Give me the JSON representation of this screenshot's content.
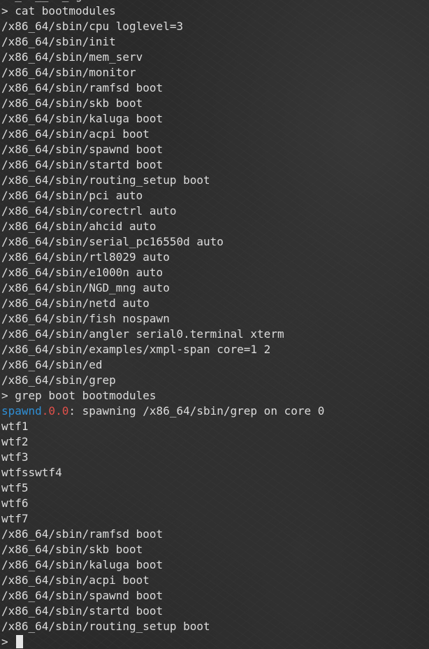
{
  "terminal": {
    "lines": [
      {
        "text": "  _  __  _ g"
      },
      {
        "text": "> cat bootmodules"
      },
      {
        "text": "/x86_64/sbin/cpu loglevel=3"
      },
      {
        "text": "/x86_64/sbin/init"
      },
      {
        "text": "/x86_64/sbin/mem_serv"
      },
      {
        "text": "/x86_64/sbin/monitor"
      },
      {
        "text": "/x86_64/sbin/ramfsd boot"
      },
      {
        "text": "/x86_64/sbin/skb boot"
      },
      {
        "text": "/x86_64/sbin/kaluga boot"
      },
      {
        "text": "/x86_64/sbin/acpi boot"
      },
      {
        "text": "/x86_64/sbin/spawnd boot"
      },
      {
        "text": "/x86_64/sbin/startd boot"
      },
      {
        "text": "/x86_64/sbin/routing_setup boot"
      },
      {
        "text": "/x86_64/sbin/pci auto"
      },
      {
        "text": "/x86_64/sbin/corectrl auto"
      },
      {
        "text": "/x86_64/sbin/ahcid auto"
      },
      {
        "text": "/x86_64/sbin/serial_pc16550d auto"
      },
      {
        "text": "/x86_64/sbin/rtl8029 auto"
      },
      {
        "text": "/x86_64/sbin/e1000n auto"
      },
      {
        "text": "/x86_64/sbin/NGD_mng auto"
      },
      {
        "text": "/x86_64/sbin/netd auto"
      },
      {
        "text": "/x86_64/sbin/fish nospawn"
      },
      {
        "text": "/x86_64/sbin/angler serial0.terminal xterm"
      },
      {
        "text": "/x86_64/sbin/examples/xmpl-span core=1 2"
      },
      {
        "text": "/x86_64/sbin/ed"
      },
      {
        "text": "/x86_64/sbin/grep"
      },
      {
        "text": "> grep boot bootmodules"
      },
      {
        "name": "spawnd",
        "id": ".0.0",
        "text": ": spawning /x86_64/sbin/grep on core 0"
      },
      {
        "text": "wtf1"
      },
      {
        "text": "wtf2"
      },
      {
        "text": "wtf3"
      },
      {
        "text": "wtfsswtf4"
      },
      {
        "text": "wtf5"
      },
      {
        "text": "wtf6"
      },
      {
        "text": "wtf7"
      },
      {
        "text": "/x86_64/sbin/ramfsd boot"
      },
      {
        "text": "/x86_64/sbin/skb boot"
      },
      {
        "text": "/x86_64/sbin/kaluga boot"
      },
      {
        "text": "/x86_64/sbin/acpi boot"
      },
      {
        "text": "/x86_64/sbin/spawnd boot"
      },
      {
        "text": "/x86_64/sbin/startd boot"
      },
      {
        "text": "/x86_64/sbin/routing_setup boot"
      }
    ],
    "prompt": ">",
    "colors": {
      "text": "#dcdcdc",
      "service_name": "#2e8fd6",
      "service_id": "#e0504a",
      "cursor": "#e6e6e6"
    }
  }
}
